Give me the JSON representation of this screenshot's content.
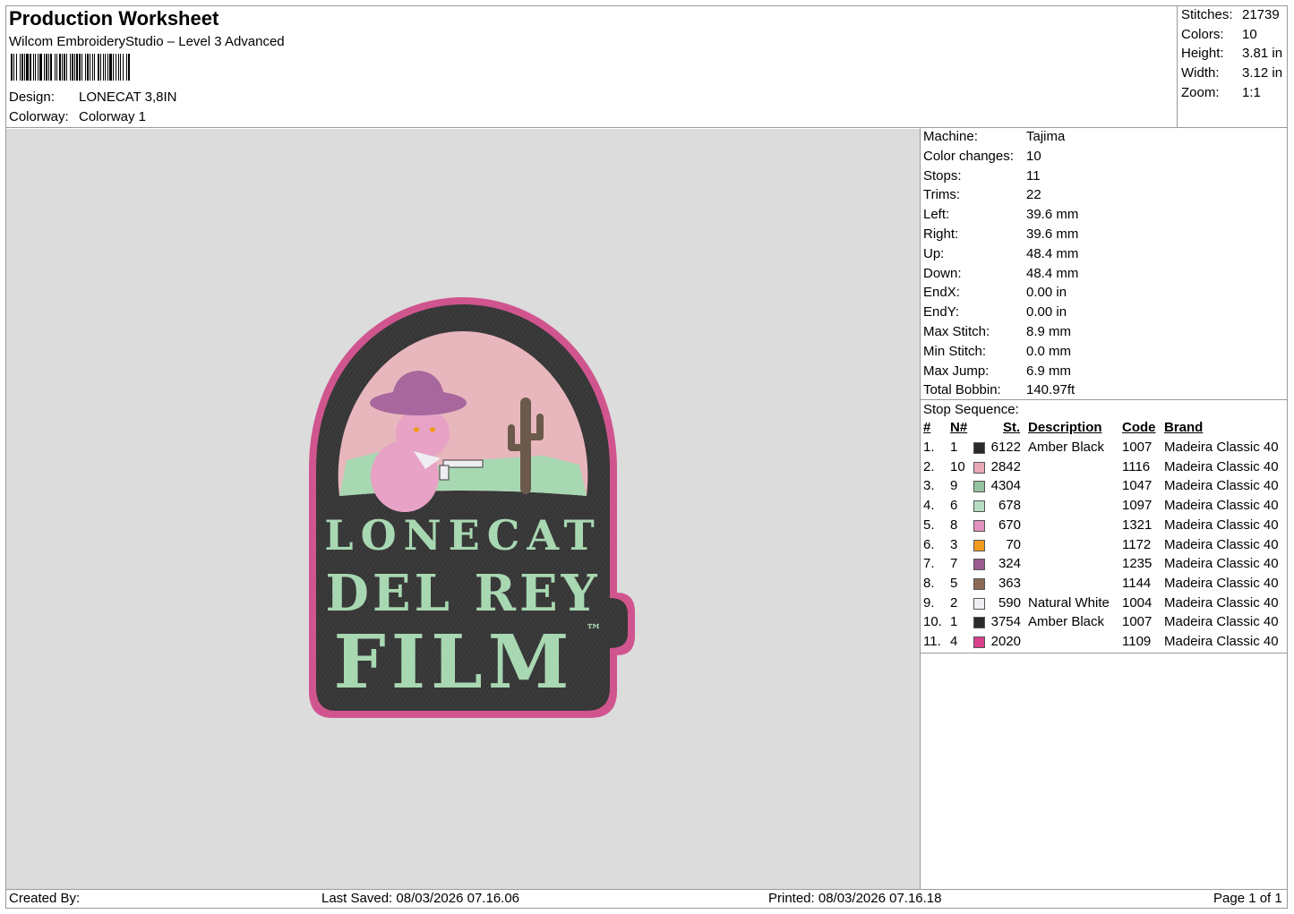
{
  "header": {
    "title": "Production Worksheet",
    "subtitle": "Wilcom EmbroideryStudio – Level 3 Advanced",
    "design_label": "Design:",
    "design_value": "LONECAT 3,8IN",
    "colorway_label": "Colorway:",
    "colorway_value": "Colorway 1"
  },
  "summary": {
    "stitches_label": "Stitches:",
    "stitches": "21739",
    "colors_label": "Colors:",
    "colors": "10",
    "height_label": "Height:",
    "height": "3.81 in",
    "width_label": "Width:",
    "width": "3.12 in",
    "zoom_label": "Zoom:",
    "zoom": "1:1"
  },
  "machine_info": [
    {
      "label": "Machine:",
      "value": "Tajima"
    },
    {
      "label": "Color changes:",
      "value": "10"
    },
    {
      "label": "Stops:",
      "value": "11"
    },
    {
      "label": "Trims:",
      "value": "22"
    },
    {
      "label": "Left:",
      "value": "39.6 mm"
    },
    {
      "label": "Right:",
      "value": "39.6 mm"
    },
    {
      "label": "Up:",
      "value": "48.4 mm"
    },
    {
      "label": "Down:",
      "value": "48.4 mm"
    },
    {
      "label": "EndX:",
      "value": "0.00 in"
    },
    {
      "label": "EndY:",
      "value": "0.00 in"
    },
    {
      "label": "Max Stitch:",
      "value": "8.9 mm"
    },
    {
      "label": "Min Stitch:",
      "value": "0.0 mm"
    },
    {
      "label": "Max Jump:",
      "value": "6.9 mm"
    },
    {
      "label": "Total Bobbin:",
      "value": "140.97ft"
    }
  ],
  "stop_sequence": {
    "title": "Stop Sequence:",
    "headers": {
      "num": "#",
      "n": "N#",
      "st": "St.",
      "description": "Description",
      "code": "Code",
      "brand": "Brand"
    },
    "rows": [
      {
        "num": "1.",
        "n": "1",
        "color": "#2a2a2a",
        "st": "6122",
        "description": "Amber Black",
        "code": "1007",
        "brand": "Madeira Classic 40"
      },
      {
        "num": "2.",
        "n": "10",
        "color": "#e8a7b6",
        "st": "2842",
        "description": "",
        "code": "1116",
        "brand": "Madeira Classic 40"
      },
      {
        "num": "3.",
        "n": "9",
        "color": "#94c29c",
        "st": "4304",
        "description": "",
        "code": "1047",
        "brand": "Madeira Classic 40"
      },
      {
        "num": "4.",
        "n": "6",
        "color": "#b6dcc1",
        "st": "678",
        "description": "",
        "code": "1097",
        "brand": "Madeira Classic 40"
      },
      {
        "num": "5.",
        "n": "8",
        "color": "#e392bd",
        "st": "670",
        "description": "",
        "code": "1321",
        "brand": "Madeira Classic 40"
      },
      {
        "num": "6.",
        "n": "3",
        "color": "#f29a1e",
        "st": "70",
        "description": "",
        "code": "1172",
        "brand": "Madeira Classic 40"
      },
      {
        "num": "7.",
        "n": "7",
        "color": "#9a5c91",
        "st": "324",
        "description": "",
        "code": "1235",
        "brand": "Madeira Classic 40"
      },
      {
        "num": "8.",
        "n": "5",
        "color": "#8b6a55",
        "st": "363",
        "description": "",
        "code": "1144",
        "brand": "Madeira Classic 40"
      },
      {
        "num": "9.",
        "n": "2",
        "color": "#efeef3",
        "st": "590",
        "description": "Natural White",
        "code": "1004",
        "brand": "Madeira Classic 40"
      },
      {
        "num": "10.",
        "n": "1",
        "color": "#2a2a2a",
        "st": "3754",
        "description": "Amber Black",
        "code": "1007",
        "brand": "Madeira Classic 40"
      },
      {
        "num": "11.",
        "n": "4",
        "color": "#d8408c",
        "st": "2020",
        "description": "",
        "code": "1109",
        "brand": "Madeira Classic 40"
      }
    ]
  },
  "design_preview": {
    "line1": "LONECAT",
    "line2": "DEL REY",
    "line3": "FILM",
    "trademark": "™",
    "colors": {
      "border": "#d0558f",
      "fill": "#3a3a3a",
      "sky": "#e8b7bd",
      "text": "#a8d8b2",
      "cat": "#e7a2c6",
      "hat": "#a8679d",
      "cactus": "#6b5a4c"
    }
  },
  "footer": {
    "created_by": "Created By:",
    "last_saved": "Last Saved: 08/03/2026 07.16.06",
    "printed": "Printed: 08/03/2026 07.16.18",
    "page": "Page 1 of 1"
  }
}
